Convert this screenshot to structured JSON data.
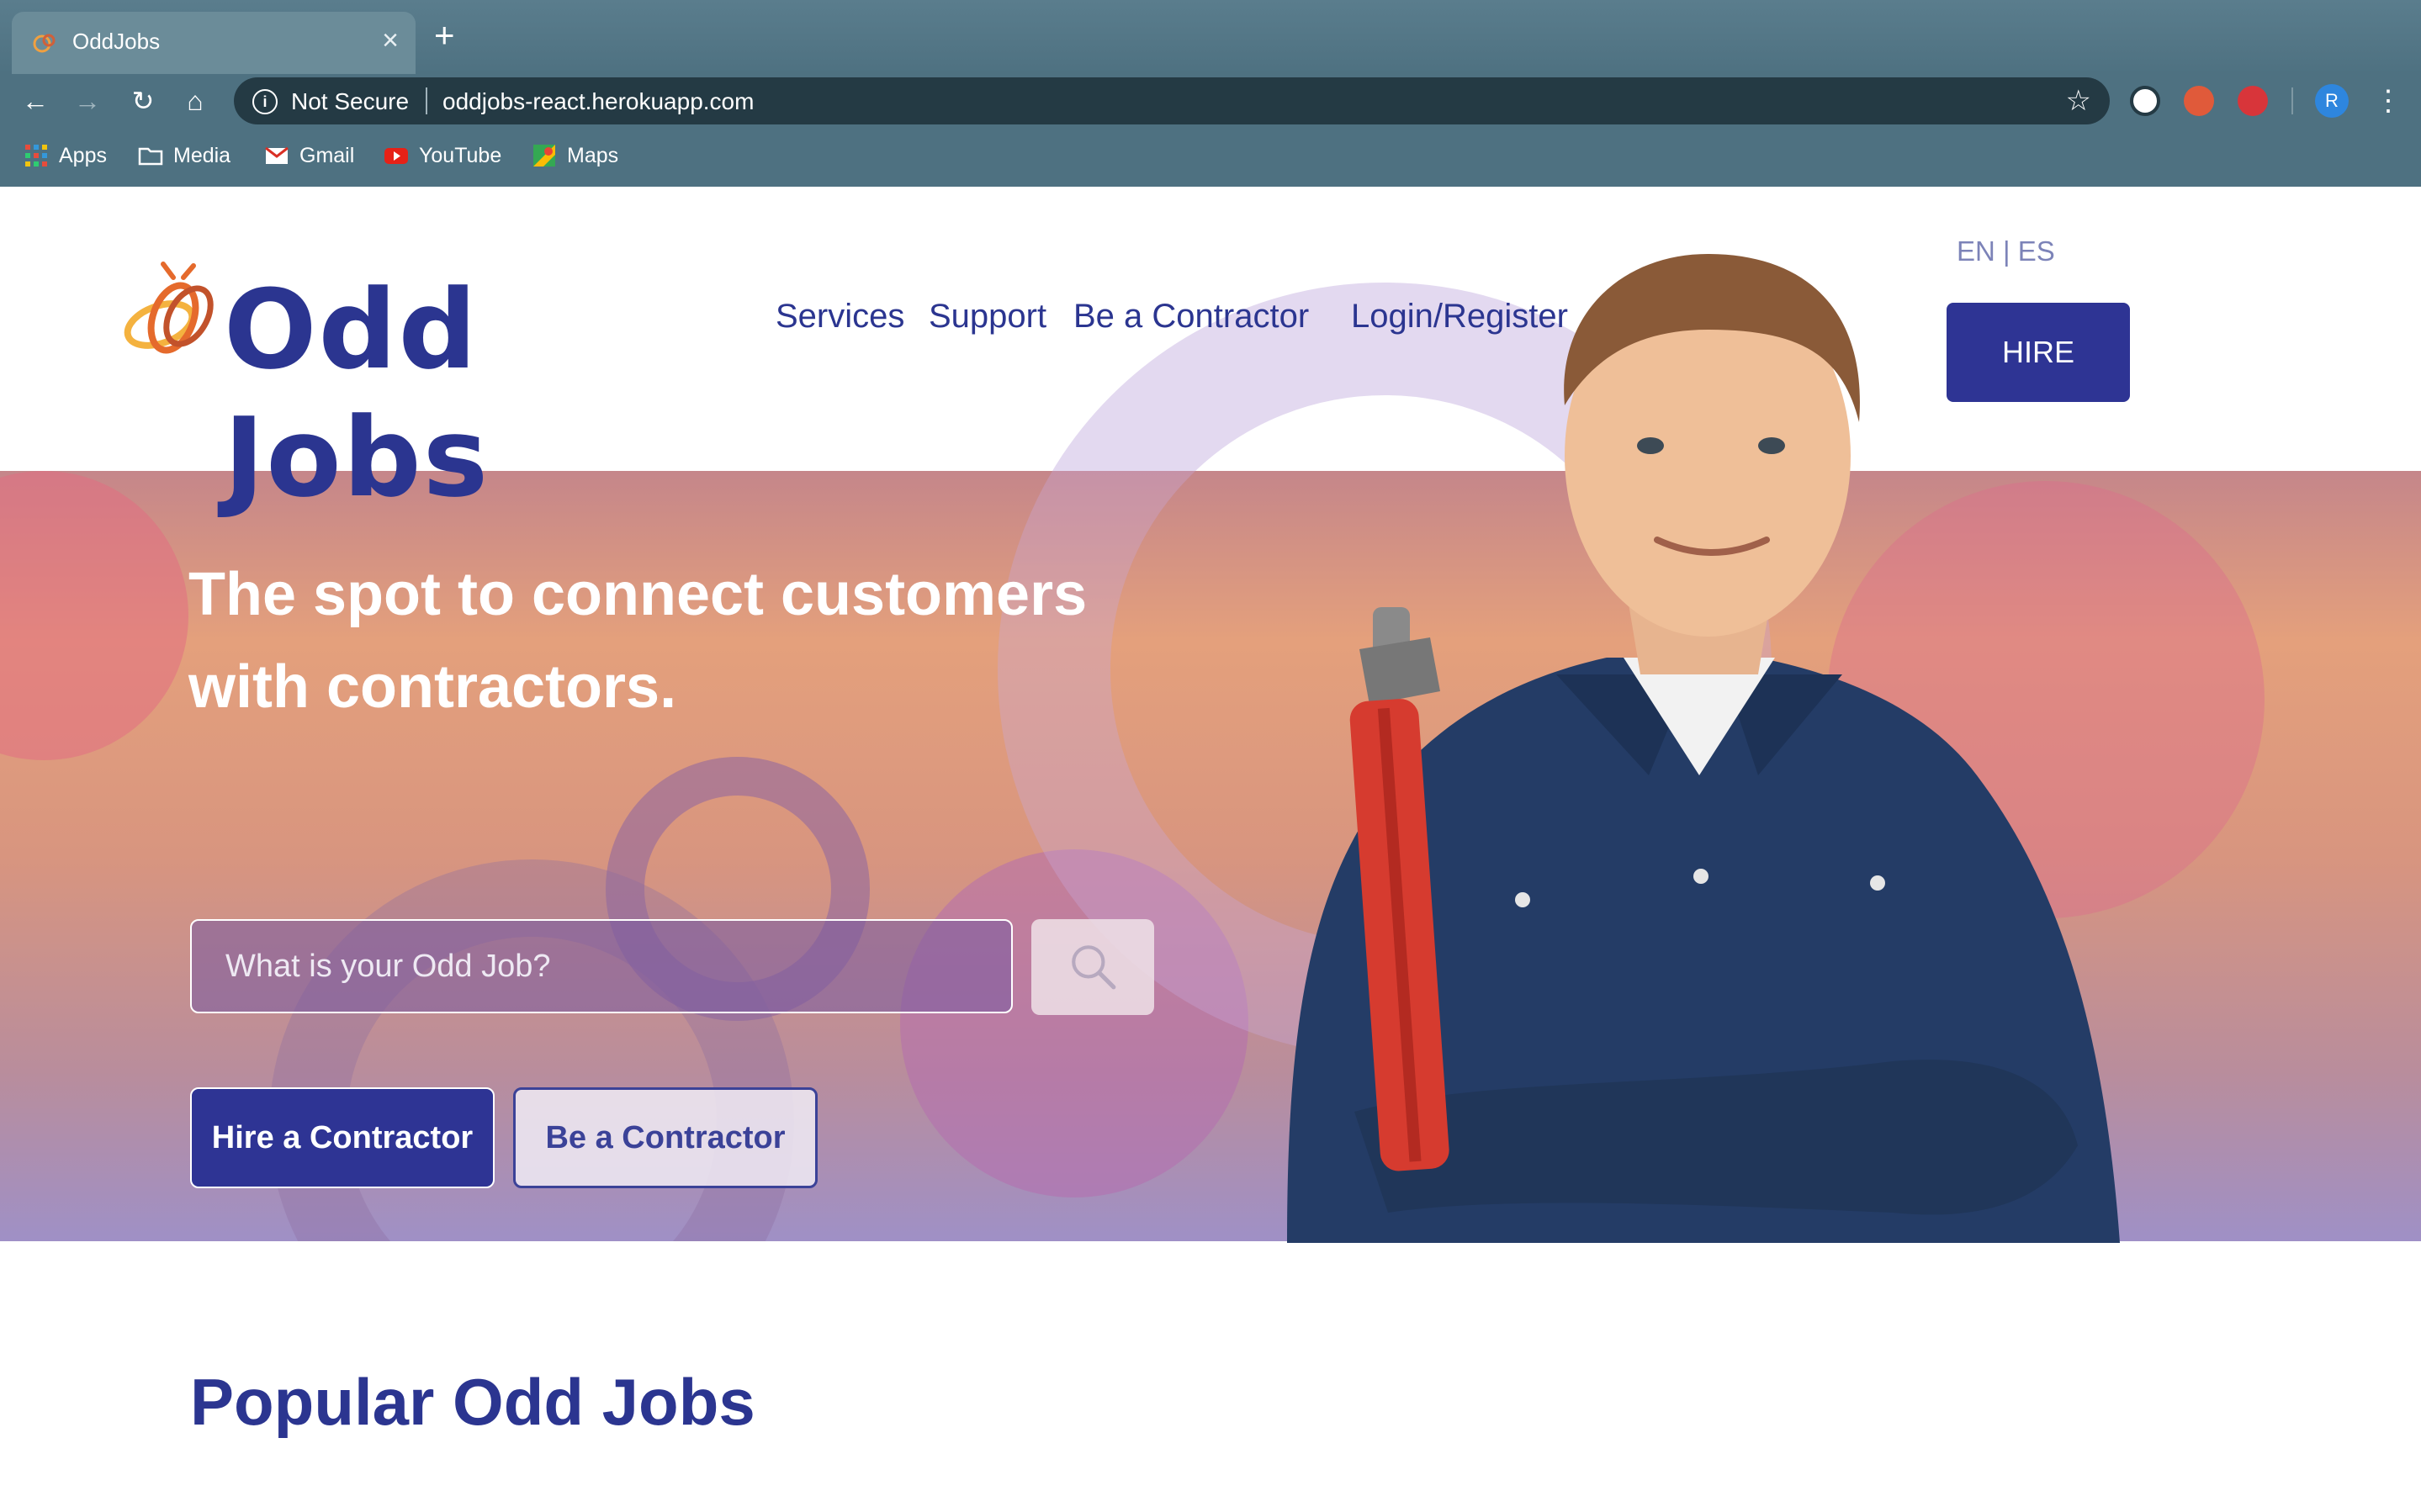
{
  "browser": {
    "tab_title": "OddJobs",
    "security_label": "Not Secure",
    "url": "oddjobs-react.herokuapp.com",
    "profile_initial": "R",
    "bookmarks": [
      {
        "label": "Apps",
        "icon": "apps-grid-icon"
      },
      {
        "label": "Media",
        "icon": "folder-icon"
      },
      {
        "label": "Gmail",
        "icon": "gmail-icon"
      },
      {
        "label": "YouTube",
        "icon": "youtube-icon"
      },
      {
        "label": "Maps",
        "icon": "maps-icon"
      }
    ]
  },
  "site": {
    "logo_text": "Odd Jobs",
    "nav": [
      "Services",
      "Support",
      "Be a Contractor",
      "Login/Register"
    ],
    "lang": {
      "en": "EN",
      "sep": " | ",
      "es": "ES"
    },
    "hire_button": "HIRE",
    "colors": {
      "brand": "#2e3494",
      "hero_top": "#e4a07c",
      "hero_bottom": "#9f90c6"
    }
  },
  "hero": {
    "headline_line1": "The spot to connect customers",
    "headline_line2": "with contractors.",
    "search_placeholder": "What is your Odd Job?",
    "buttons": {
      "hire": "Hire a Contractor",
      "be": "Be a Contractor"
    }
  },
  "sections": {
    "popular_title": "Popular Odd Jobs"
  }
}
